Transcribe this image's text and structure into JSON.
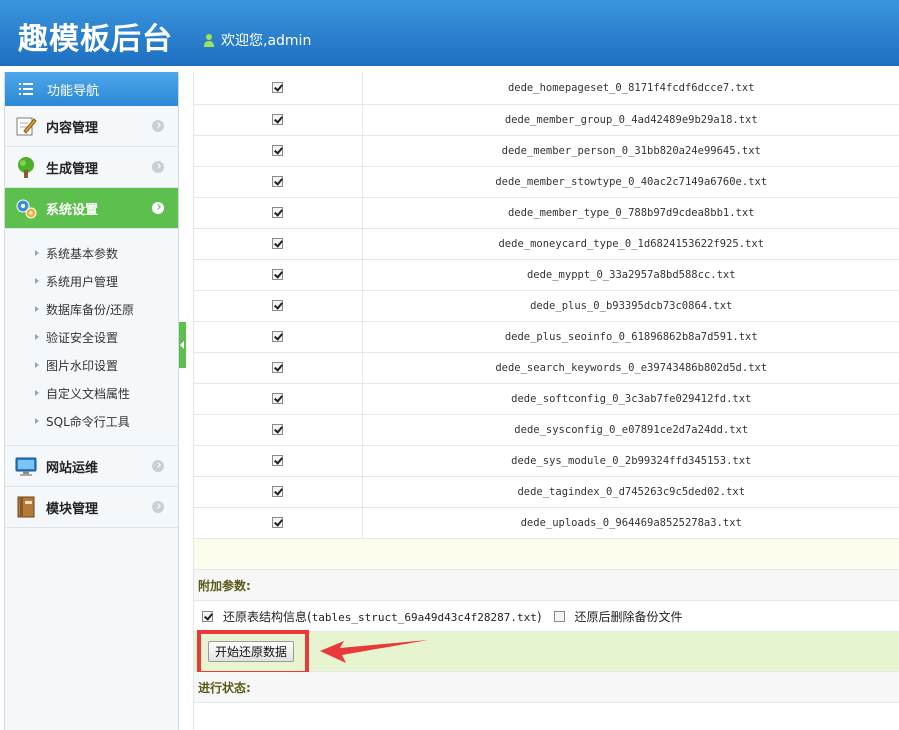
{
  "header": {
    "brand": "趣模板后台",
    "welcome": "欢迎您,admin"
  },
  "sidebar": {
    "title": "功能导航",
    "sections": [
      {
        "label": "内容管理",
        "icon": "edit-icon"
      },
      {
        "label": "生成管理",
        "icon": "tree-icon"
      },
      {
        "label": "系统设置",
        "icon": "gears-icon",
        "active": true
      },
      {
        "label": "网站运维",
        "icon": "monitor-icon"
      },
      {
        "label": "模块管理",
        "icon": "book-icon"
      }
    ],
    "subitems": [
      "系统基本参数",
      "系统用户管理",
      "数据库备份/还原",
      "验证安全设置",
      "图片水印设置",
      "自定义文档属性",
      "SQL命令行工具"
    ]
  },
  "files": [
    "dede_homepageset_0_8171f4fcdf6dcce7.txt",
    "dede_member_group_0_4ad42489e9b29a18.txt",
    "dede_member_person_0_31bb820a24e99645.txt",
    "dede_member_stowtype_0_40ac2c7149a6760e.txt",
    "dede_member_type_0_788b97d9cdea8bb1.txt",
    "dede_moneycard_type_0_1d6824153622f925.txt",
    "dede_myppt_0_33a2957a8bd588cc.txt",
    "dede_plus_0_b93395dcb73c0864.txt",
    "dede_plus_seoinfo_0_61896862b8a7d591.txt",
    "dede_search_keywords_0_e39743486b802d5d.txt",
    "dede_softconfig_0_3c3ab7fe029412fd.txt",
    "dede_sysconfig_0_e07891ce2d7a24dd.txt",
    "dede_sys_module_0_2b99324ffd345153.txt",
    "dede_tagindex_0_d745263c9c5ded02.txt",
    "dede_uploads_0_964469a8525278a3.txt"
  ],
  "extra": {
    "label": "附加参数:",
    "restore_struct": "还原表结构信息(",
    "struct_file": "tables_struct_69a49d43c4f28287.txt",
    "restore_struct_close": ")",
    "delete_after": "还原后删除备份文件"
  },
  "actions": {
    "start_label": "开始还原数据"
  },
  "status": {
    "label": "进行状态:"
  },
  "colors": {
    "header": "#2b82d0",
    "active_nav": "#5cbf4e",
    "highlight": "#e83a3a"
  }
}
